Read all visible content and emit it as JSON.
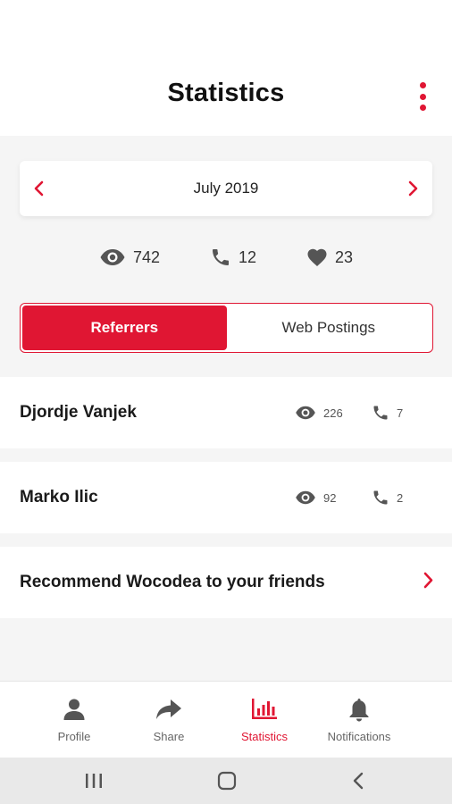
{
  "header": {
    "title": "Statistics",
    "menu_icon": "kebab-menu-icon"
  },
  "period": {
    "label": "July 2019",
    "prev_icon": "chevron-left-icon",
    "next_icon": "chevron-right-icon"
  },
  "summary": {
    "views": "742",
    "calls": "12",
    "likes": "23"
  },
  "tabs": {
    "active_label": "Referrers",
    "inactive_label": "Web Postings"
  },
  "referrers": [
    {
      "name": "Djordje Vanjek",
      "views": "226",
      "calls": "7"
    },
    {
      "name": "Marko Ilic",
      "views": "92",
      "calls": "2"
    }
  ],
  "recommend": {
    "label": "Recommend Wocodea to your friends"
  },
  "bottom_nav": {
    "items": [
      {
        "label": "Profile",
        "icon": "person-icon"
      },
      {
        "label": "Share",
        "icon": "share-arrow-icon"
      },
      {
        "label": "Statistics",
        "icon": "bar-chart-icon"
      },
      {
        "label": "Notifications",
        "icon": "bell-icon"
      }
    ],
    "active": "Statistics"
  },
  "colors": {
    "accent": "#e01633",
    "background": "#f5f5f5",
    "card": "#ffffff"
  }
}
